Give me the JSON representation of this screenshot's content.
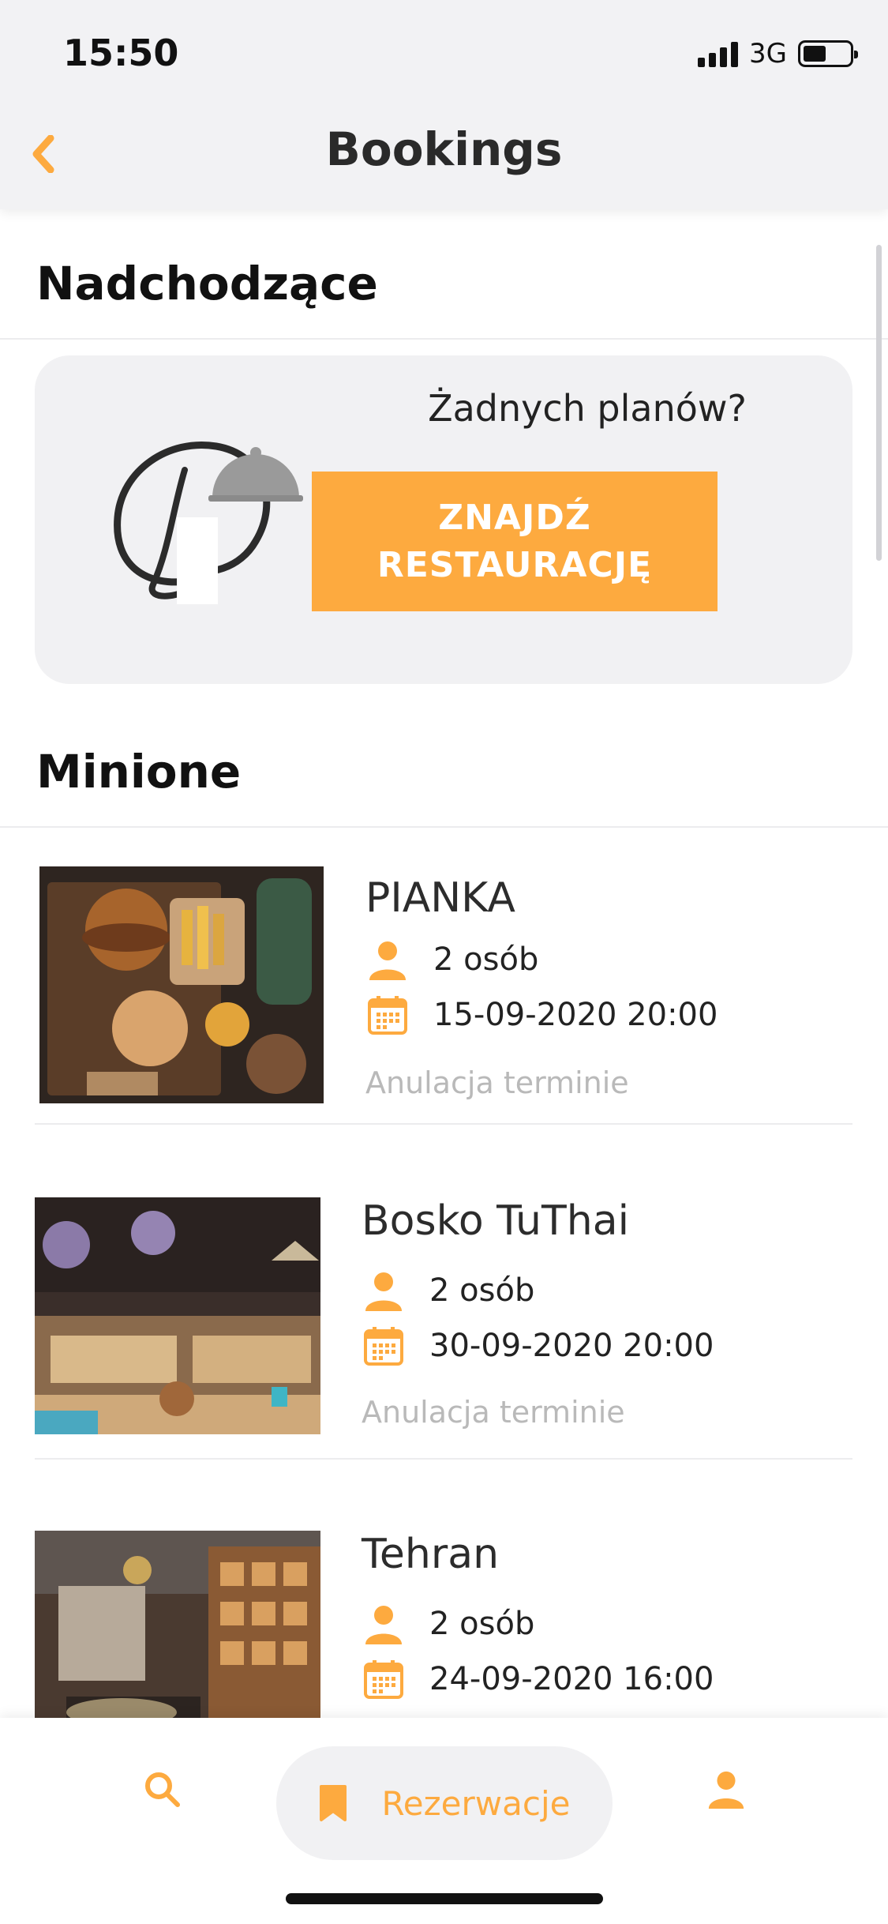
{
  "status_bar": {
    "time": "15:50",
    "network": "3G",
    "battery_level": 0.5
  },
  "header": {
    "title": "Bookings",
    "back_icon": "chevron-left-icon"
  },
  "upcoming": {
    "title": "Nadchodzące",
    "empty_card": {
      "question": "Żadnych planów?",
      "cta_line1": "ZNAJDŹ",
      "cta_line2": "RESTAURACJĘ"
    }
  },
  "past": {
    "title": "Minione",
    "bookings": [
      {
        "name": "PIANKA",
        "people": "2 osób",
        "datetime": "15-09-2020 20:00",
        "status": "Anulacja terminie"
      },
      {
        "name": "Bosko TuThai",
        "people": "2 osób",
        "datetime": "30-09-2020 20:00",
        "status": "Anulacja terminie"
      },
      {
        "name": "Tehran",
        "people": "2 osób",
        "datetime": "24-09-2020 16:00"
      }
    ]
  },
  "bottom_nav": {
    "search_icon": "search-icon",
    "active_label": "Rezerwacje",
    "bookmark_icon": "bookmark-icon",
    "profile_icon": "user-icon"
  },
  "colors": {
    "accent": "#fdaa3f",
    "muted": "#b9b9b9",
    "card_bg": "#f1f1f3"
  }
}
